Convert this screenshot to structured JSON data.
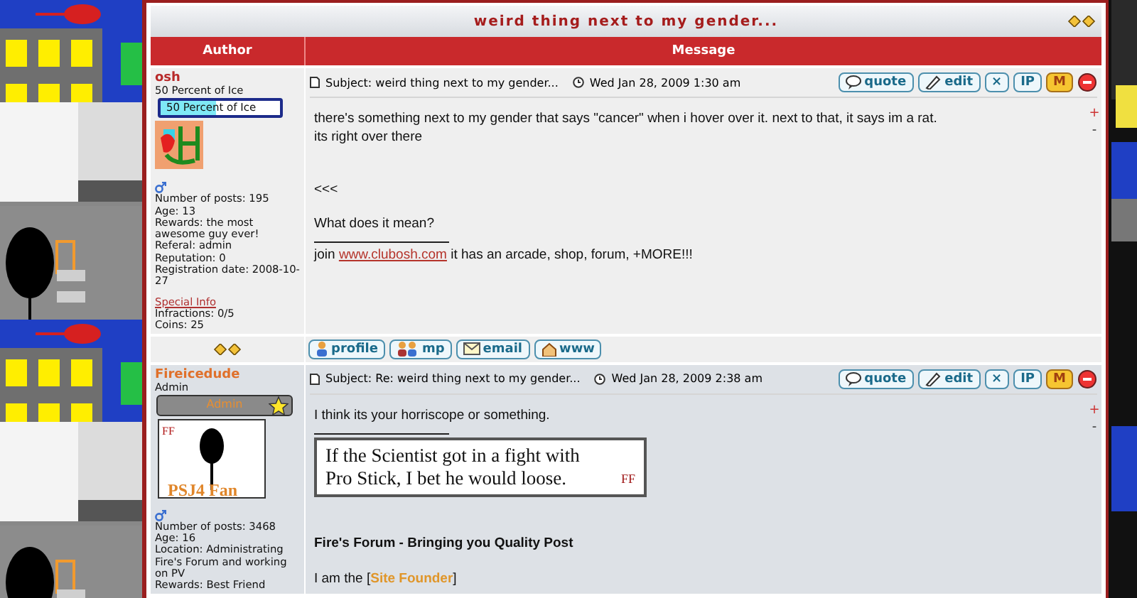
{
  "topic": {
    "title": "weird thing next to my gender..."
  },
  "columns": [
    "Author",
    "Message"
  ],
  "posts": [
    {
      "author": "osh",
      "rank": "50 Percent of Ice",
      "rank_bar": {
        "kind": "progress",
        "text": "50 Percent of Ice",
        "level": 0.46
      },
      "avatar": {
        "kind": "logo"
      },
      "details": [
        "Number of posts: 195",
        "Age: 13",
        "Rewards: the most awesome guy ever!",
        "Referal: admin",
        "Reputation: 0",
        "Registration date: 2008-10-27"
      ],
      "special_info": "Special Info",
      "extra_details": [
        "Infractions: 0/5",
        "Coins: 25"
      ],
      "subject": "Subject: weird thing next to my gender...",
      "date": "Wed Jan 28, 2009 1:30 am",
      "actions": [
        {
          "kind": "quote",
          "label": "quote"
        },
        {
          "kind": "edit",
          "label": "edit"
        },
        {
          "kind": "box",
          "label": "×"
        },
        {
          "kind": "box",
          "label": "IP"
        },
        {
          "kind": "badge",
          "label": "M"
        },
        {
          "kind": "disc"
        }
      ],
      "resize": [
        "+",
        "-"
      ],
      "body": [
        {
          "lines": [
            " there's something next to my gender that says \"cancer\" when i hover over it. next to that, it says im a rat.",
            "its right over there"
          ]
        },
        {
          "lines": [
            "<<<"
          ]
        },
        {
          "lines": [
            "What does it mean?"
          ]
        }
      ],
      "signature": [
        {
          "kind": "link",
          "before": "join ",
          "link": "www.clubosh.com",
          "after": " it has an arcade, shop, forum, +MORE!!!"
        }
      ],
      "footer": [
        {
          "kind": "person",
          "label": "profile"
        },
        {
          "kind": "people",
          "label": "mp"
        },
        {
          "kind": "mail",
          "label": "email"
        },
        {
          "kind": "home",
          "label": "www"
        }
      ]
    },
    {
      "author": "Fireicedude",
      "rank": "Admin",
      "rank_bar": {
        "kind": "star",
        "text": "Admin"
      },
      "avatar": {
        "kind": "fan",
        "mark": "FF",
        "caption": "PSJ4 Fan"
      },
      "details": [
        "Number of posts: 3468",
        "Age: 16",
        "Location: Administrating Fire's Forum and working on PV",
        "Rewards: Best Friend"
      ],
      "subject": "Subject: Re: weird thing next to my gender...",
      "date": "Wed Jan 28, 2009 2:38 am",
      "actions": [
        {
          "kind": "quote",
          "label": "quote"
        },
        {
          "kind": "edit",
          "label": "edit"
        },
        {
          "kind": "box",
          "label": "×"
        },
        {
          "kind": "box",
          "label": "IP"
        },
        {
          "kind": "badge",
          "label": "M"
        },
        {
          "kind": "disc"
        }
      ],
      "resize": [
        "+",
        "-"
      ],
      "body": [
        {
          "lines": [
            "I think its your horriscope or something."
          ]
        }
      ],
      "signature": [
        {
          "kind": "image",
          "lines": [
            "If the Scientist got in a fight with",
            "Pro Stick, I bet he would loose."
          ],
          "mark": "FF"
        },
        {
          "kind": "bold",
          "text": "Fire's Forum - Bringing you Quality Post"
        },
        {
          "kind": "tag",
          "before": "I am the [",
          "link": "Site Founder",
          "after": "]"
        }
      ]
    }
  ]
}
